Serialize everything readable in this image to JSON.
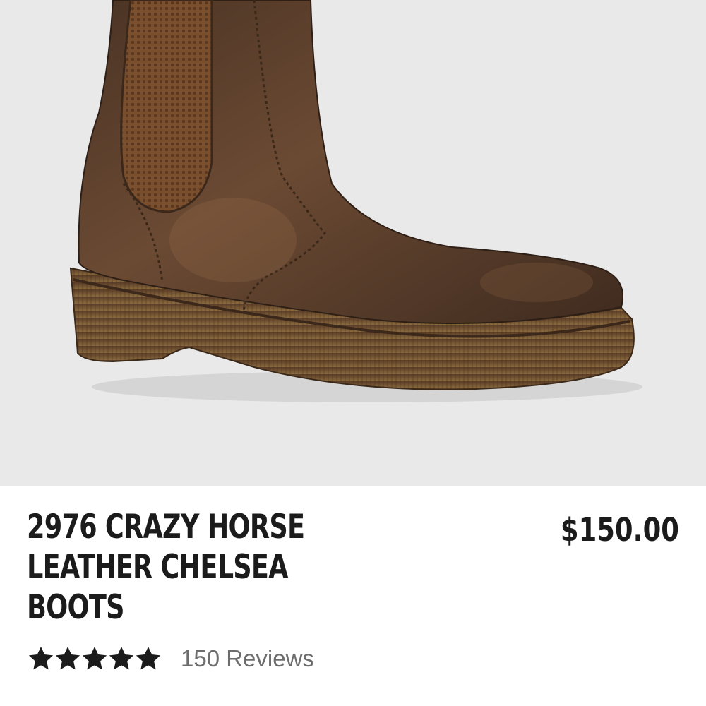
{
  "product": {
    "image_name": "boot-image",
    "title_lines": [
      "2976 CRAZY HORSE",
      "LEATHER CHELSEA",
      "BOOTS"
    ],
    "price": "$150.00",
    "rating": {
      "stars": 5,
      "max_stars": 5,
      "star_icon": "star-icon",
      "reviews_label": "150 Reviews"
    }
  },
  "colors": {
    "background": "#e9e9ea",
    "text": "#1b1b1b",
    "muted_text": "#6d6d6d",
    "leather": "#5a3d2a",
    "sole": "#6a4a2e"
  }
}
